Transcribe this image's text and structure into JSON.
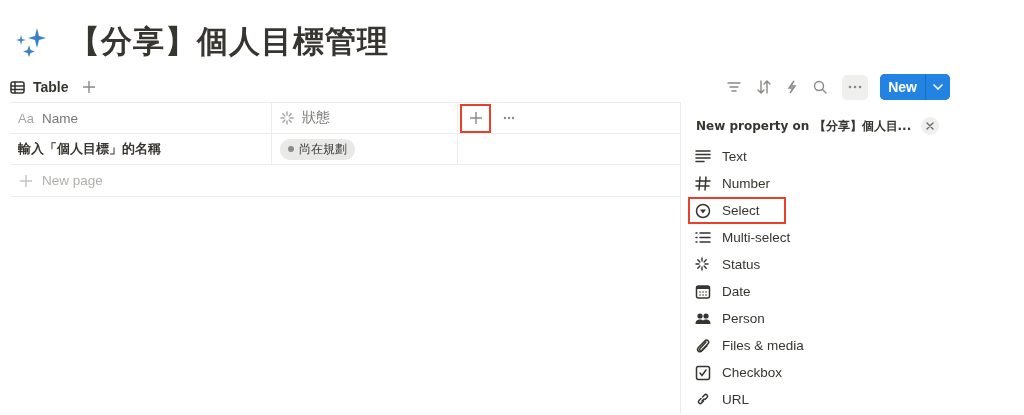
{
  "page": {
    "title": "【分享】個人目標管理"
  },
  "view_tabs": [
    {
      "label": "Table",
      "selected": true
    }
  ],
  "toolbar": {
    "new_button": "New"
  },
  "table": {
    "columns": [
      {
        "label": "Name",
        "type_mark": "Aa"
      },
      {
        "label": "狀態"
      }
    ],
    "add_column_highlighted": true,
    "rows": [
      {
        "name": "輸入「個人目標」的名稱",
        "status": "尚在規劃"
      }
    ],
    "new_row_label": "New page"
  },
  "property_menu": {
    "title": "New property on 【分享】個人目...",
    "items": [
      {
        "label": "Text",
        "highlighted": false
      },
      {
        "label": "Number",
        "highlighted": false
      },
      {
        "label": "Select",
        "highlighted": true
      },
      {
        "label": "Multi-select",
        "highlighted": false
      },
      {
        "label": "Status",
        "highlighted": false
      },
      {
        "label": "Date",
        "highlighted": false
      },
      {
        "label": "Person",
        "highlighted": false
      },
      {
        "label": "Files & media",
        "highlighted": false
      },
      {
        "label": "Checkbox",
        "highlighted": false
      },
      {
        "label": "URL",
        "highlighted": false
      }
    ]
  }
}
